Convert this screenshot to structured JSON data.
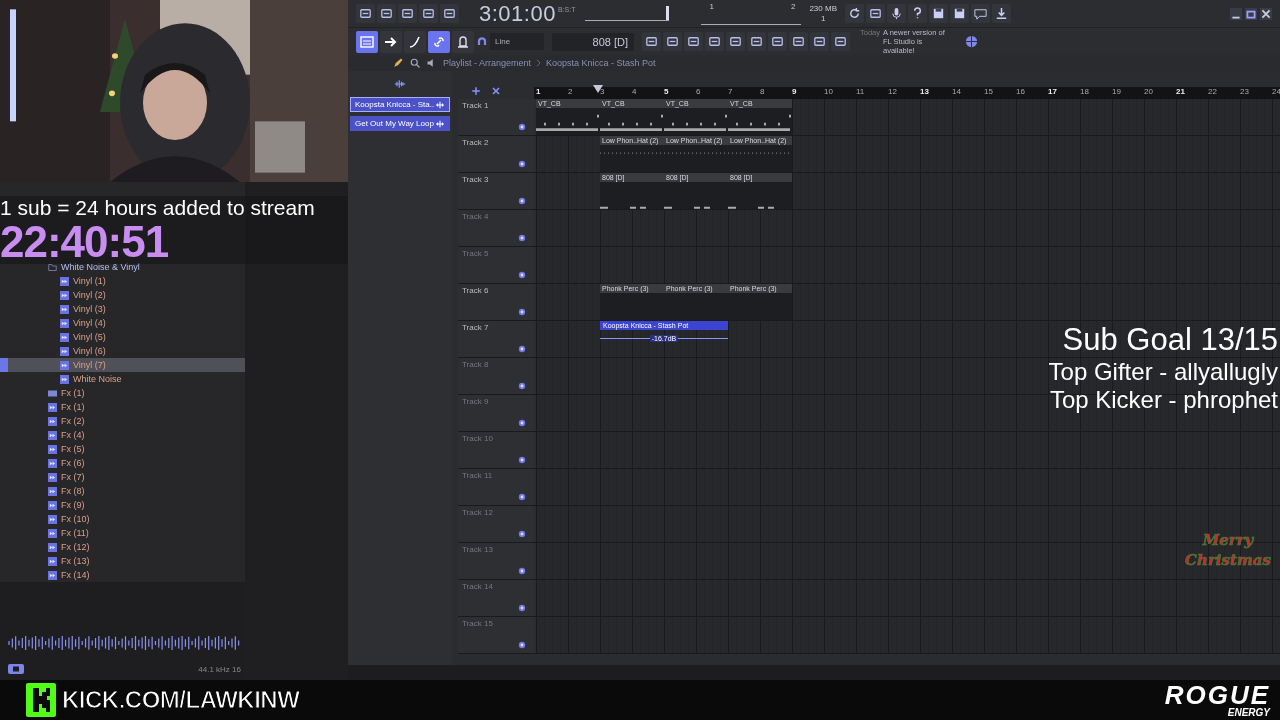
{
  "webcam": {
    "kind": "picture"
  },
  "stream_overlay": {
    "sub_rule": "1 sub = 24 hours added to stream",
    "timer": "22:40:51",
    "sub_goal": "Sub Goal 13/15",
    "top_gifter": "Top Gifter - allyallugly",
    "top_kicker": "Top Kicker - phrophet",
    "holiday_badge": "Merry Christmas",
    "channel_url": "KICK.COM/LAWKINW",
    "sponsor": "ROGUE",
    "sponsor_sub": "ENERGY"
  },
  "browser": {
    "items": [
      {
        "kind": "folder",
        "label": "White Noise & Vinyl",
        "selected": false,
        "children": [
          {
            "kind": "audio",
            "label": "Vinyl (1)",
            "selected": false
          },
          {
            "kind": "audio",
            "label": "Vinyl (2)",
            "selected": false
          },
          {
            "kind": "audio",
            "label": "Vinyl (3)",
            "selected": false
          },
          {
            "kind": "audio",
            "label": "Vinyl (4)",
            "selected": false
          },
          {
            "kind": "audio",
            "label": "Vinyl (5)",
            "selected": false
          },
          {
            "kind": "audio",
            "label": "Vinyl (6)",
            "selected": false
          },
          {
            "kind": "audio",
            "label": "Vinyl (7)",
            "selected": true
          },
          {
            "kind": "audio",
            "label": "White Noise",
            "selected": false
          }
        ]
      },
      {
        "kind": "mp3",
        "label": "Fx (1)",
        "selected": false
      },
      {
        "kind": "audio",
        "label": "Fx (1)",
        "selected": false
      },
      {
        "kind": "audio",
        "label": "Fx (2)",
        "selected": false
      },
      {
        "kind": "audio",
        "label": "Fx (4)",
        "selected": false
      },
      {
        "kind": "audio",
        "label": "Fx (5)",
        "selected": false
      },
      {
        "kind": "audio",
        "label": "Fx (6)",
        "selected": false
      },
      {
        "kind": "audio",
        "label": "Fx (7)",
        "selected": false
      },
      {
        "kind": "audio",
        "label": "Fx (8)",
        "selected": false
      },
      {
        "kind": "audio",
        "label": "Fx (9)",
        "selected": false
      },
      {
        "kind": "audio",
        "label": "Fx (10)",
        "selected": false
      },
      {
        "kind": "audio",
        "label": "Fx (11)",
        "selected": false
      },
      {
        "kind": "audio",
        "label": "Fx (12)",
        "selected": false
      },
      {
        "kind": "audio",
        "label": "Fx (13)",
        "selected": false
      },
      {
        "kind": "audio",
        "label": "Fx (14)",
        "selected": false
      }
    ],
    "sample_info": "44.1 kHz 16"
  },
  "toolbar": {
    "time": "3:01:00",
    "time_format": "B:S:T",
    "cpu_mark_1": "1",
    "cpu_mark_2": "2",
    "memory": "230 MB",
    "voices": "1",
    "snap": "Line",
    "pattern": "808 [D]",
    "news_date": "Today",
    "news": "A newer version of FL Studio is available!",
    "master_slider": {
      "level": 1.0
    }
  },
  "mode_buttons": [
    {
      "kind": "pattern",
      "on": true
    },
    {
      "kind": "arrow",
      "on": false
    },
    {
      "kind": "curve",
      "on": false
    },
    {
      "kind": "link",
      "on": true
    },
    {
      "kind": "bell",
      "on": false
    }
  ],
  "breadcrumb": [
    "Playlist - Arrangement",
    "Koopsta Knicca - Stash Pot"
  ],
  "picker": [
    {
      "label": "Koopsta Knicca - Sta..",
      "selected": true
    },
    {
      "label": "Get Out My Way Loop",
      "selected": false
    }
  ],
  "ruler": [
    "1",
    "2",
    "3",
    "4",
    "5",
    "6",
    "7",
    "8",
    "9",
    "10",
    "11",
    "12",
    "13",
    "14",
    "15",
    "16",
    "17",
    "18",
    "19",
    "20",
    "21",
    "22",
    "23",
    "24"
  ],
  "tracks": [
    {
      "name": "Track 1",
      "empty": false,
      "clips": [
        {
          "kind": "pattern",
          "label": "VT_CB"
        },
        {
          "kind": "pattern",
          "label": "VT_CB"
        },
        {
          "kind": "pattern",
          "label": "VT_CB"
        },
        {
          "kind": "pattern",
          "label": "VT_CB"
        }
      ]
    },
    {
      "name": "Track 2",
      "empty": false,
      "clips": [
        {
          "kind": "pattern",
          "label": "Low Phon..Hat (2)"
        },
        {
          "kind": "pattern",
          "label": "Low Phon..Hat (2)"
        },
        {
          "kind": "pattern",
          "label": "Low Phon..Hat (2)"
        }
      ]
    },
    {
      "name": "Track 3",
      "empty": false,
      "clips": [
        {
          "kind": "pattern",
          "label": "808 [D]"
        },
        {
          "kind": "pattern",
          "label": "808 [D]"
        },
        {
          "kind": "pattern",
          "label": "808 [D]"
        }
      ]
    },
    {
      "name": "Track 4",
      "empty": true
    },
    {
      "name": "Track 5",
      "empty": true
    },
    {
      "name": "Track 6",
      "empty": false,
      "clips": [
        {
          "kind": "pattern",
          "label": "Phonk Perc (3)"
        },
        {
          "kind": "pattern",
          "label": "Phonk Perc (3)"
        },
        {
          "kind": "pattern",
          "label": "Phonk Perc (3)"
        }
      ]
    },
    {
      "name": "Track 7",
      "empty": false,
      "clips": [
        {
          "kind": "audio",
          "label": "Koopsta Knicca - Stash Pot",
          "gain": "-16.7dB"
        }
      ]
    },
    {
      "name": "Track 8",
      "empty": true
    },
    {
      "name": "Track 9",
      "empty": true
    },
    {
      "name": "Track 10",
      "empty": true
    },
    {
      "name": "Track 11",
      "empty": true
    },
    {
      "name": "Track 12",
      "empty": true
    },
    {
      "name": "Track 13",
      "empty": true
    },
    {
      "name": "Track 14",
      "empty": true
    },
    {
      "name": "Track 15",
      "empty": true
    }
  ]
}
